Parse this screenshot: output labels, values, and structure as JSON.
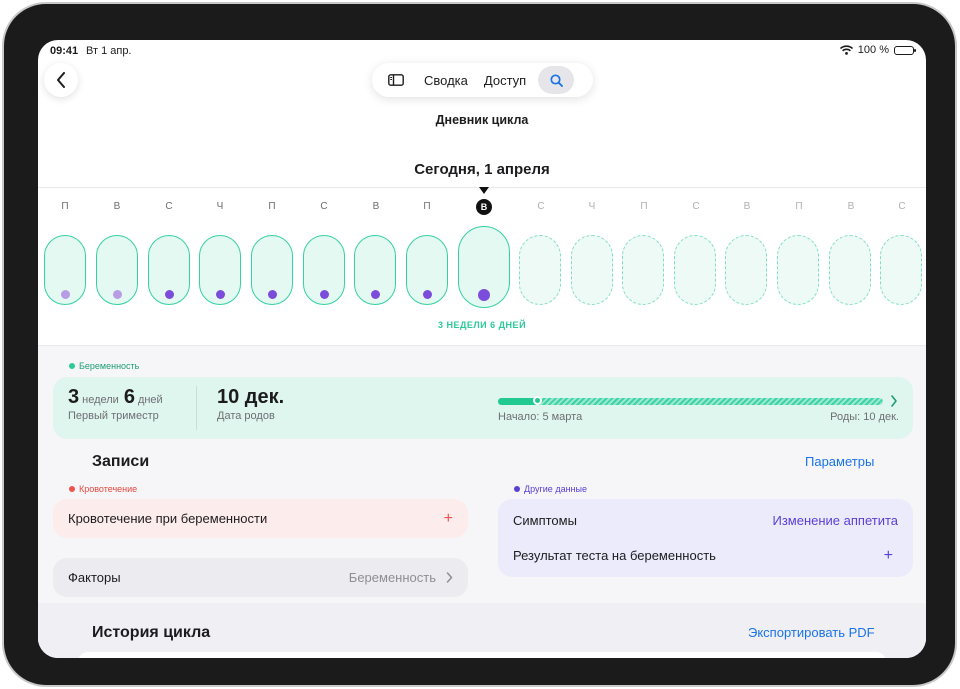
{
  "status": {
    "time": "09:41",
    "date": "Вт 1 апр.",
    "battery": "100 %"
  },
  "toolbar": {
    "summary": "Сводка",
    "access": "Доступ"
  },
  "journal": {
    "title": "Дневник цикла",
    "today": "Сегодня, 1 апреля"
  },
  "week_strip": {
    "past_letters": [
      "П",
      "В",
      "С",
      "Ч",
      "П",
      "С",
      "В",
      "П"
    ],
    "today_letter": "В",
    "future_letters": [
      "С",
      "Ч",
      "П",
      "С",
      "В",
      "П",
      "В",
      "С"
    ],
    "dot_colors": [
      "#b89ce6",
      "#b89ce6",
      "#7c4ddb",
      "#7c4ddb",
      "#7c4ddb",
      "#7c4ddb",
      "#7c4ddb",
      "#7c4ddb",
      "#7c4ddb"
    ],
    "weeks_label": "3 НЕДЕЛИ 6 ДНЕЙ"
  },
  "pregnancy": {
    "tag": "Беременность",
    "weeks_num": "3",
    "weeks_unit": "недели",
    "days_num": "6",
    "days_unit": "дней",
    "trimester": "Первый триместр",
    "due_date": "10 дек.",
    "due_label": "Дата родов",
    "start_label": "Начало: 5 марта",
    "end_label": "Роды: 10 дек.",
    "progress": 0.105
  },
  "records": {
    "title": "Записи",
    "params_link": "Параметры",
    "bleeding_tag": "Кровотечение",
    "bleeding_item": "Кровотечение при беременности",
    "factors_label": "Факторы",
    "factors_value": "Беременность",
    "other_tag": "Другие данные",
    "symptoms_label": "Симптомы",
    "symptoms_value": "Изменение аппетита",
    "test_label": "Результат теста на беременность"
  },
  "history": {
    "title": "История цикла",
    "export_link": "Экспортировать PDF"
  },
  "colors": {
    "accent_green": "#2ec99a",
    "link_blue": "#1a73e8",
    "purple": "#5b3fd6",
    "red_tag": "#ef5350"
  }
}
